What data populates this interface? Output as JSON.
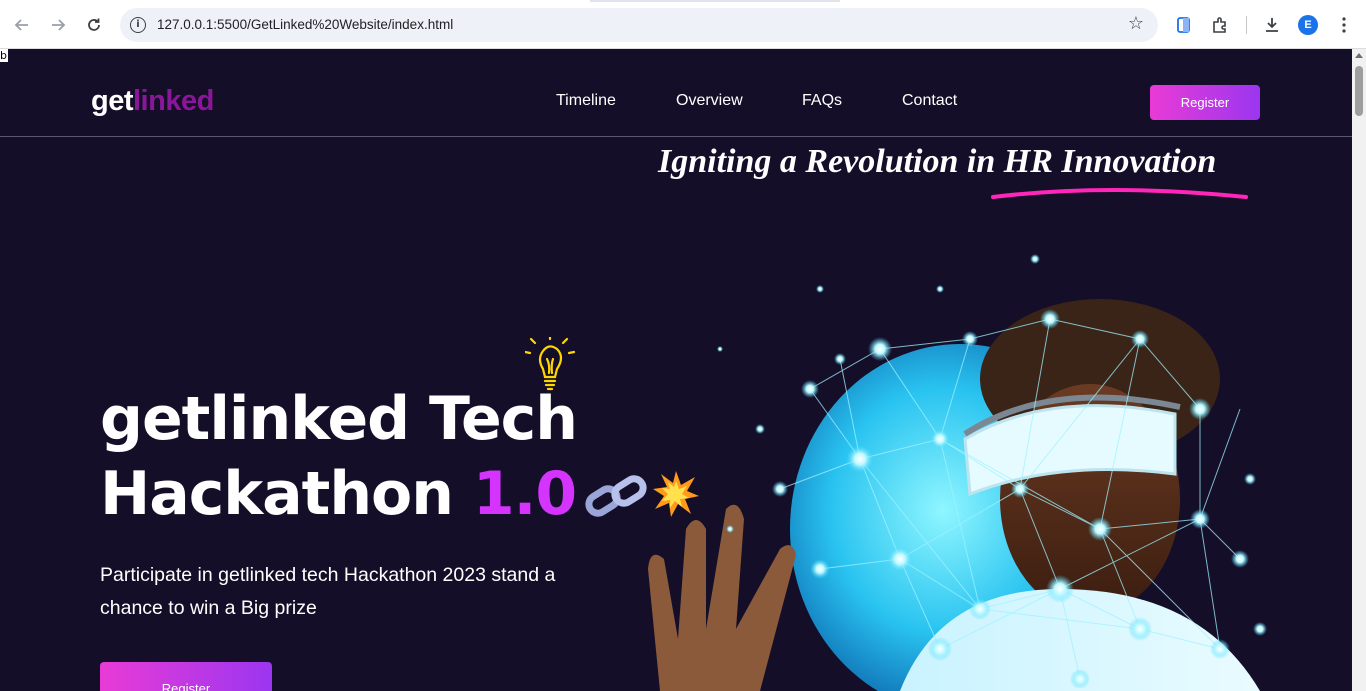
{
  "browser": {
    "url": "127.0.0.1:5500/GetLinked%20Website/index.html",
    "profile_initial": "E",
    "icons": [
      "back-icon",
      "forward-icon",
      "reload-icon",
      "info-icon",
      "star-icon",
      "google-lens-icon",
      "extensions-icon",
      "download-icon",
      "menu-icon"
    ]
  },
  "page": {
    "stray_text": "b",
    "logo": {
      "part1": "get",
      "part2": "linked"
    },
    "nav": [
      {
        "label": "Timeline"
      },
      {
        "label": "Overview"
      },
      {
        "label": "FAQs"
      },
      {
        "label": "Contact"
      }
    ],
    "header_register": "Register",
    "tagline": "Igniting a Revolution in HR Innovation",
    "hero": {
      "title_line1": "getlinked Tech",
      "title_line2_main": "Hackathon",
      "title_line2_accent": "1.0",
      "description": "Participate in getlinked tech Hackathon 2023 stand a chance to win a Big prize",
      "register": "Register"
    },
    "colors": {
      "background": "#150e28",
      "accent": "#d434fe",
      "logo_accent": "#8a1699",
      "button_start": "#e93bd6",
      "button_end": "#9b36f0",
      "underline": "#ff26b9"
    }
  }
}
